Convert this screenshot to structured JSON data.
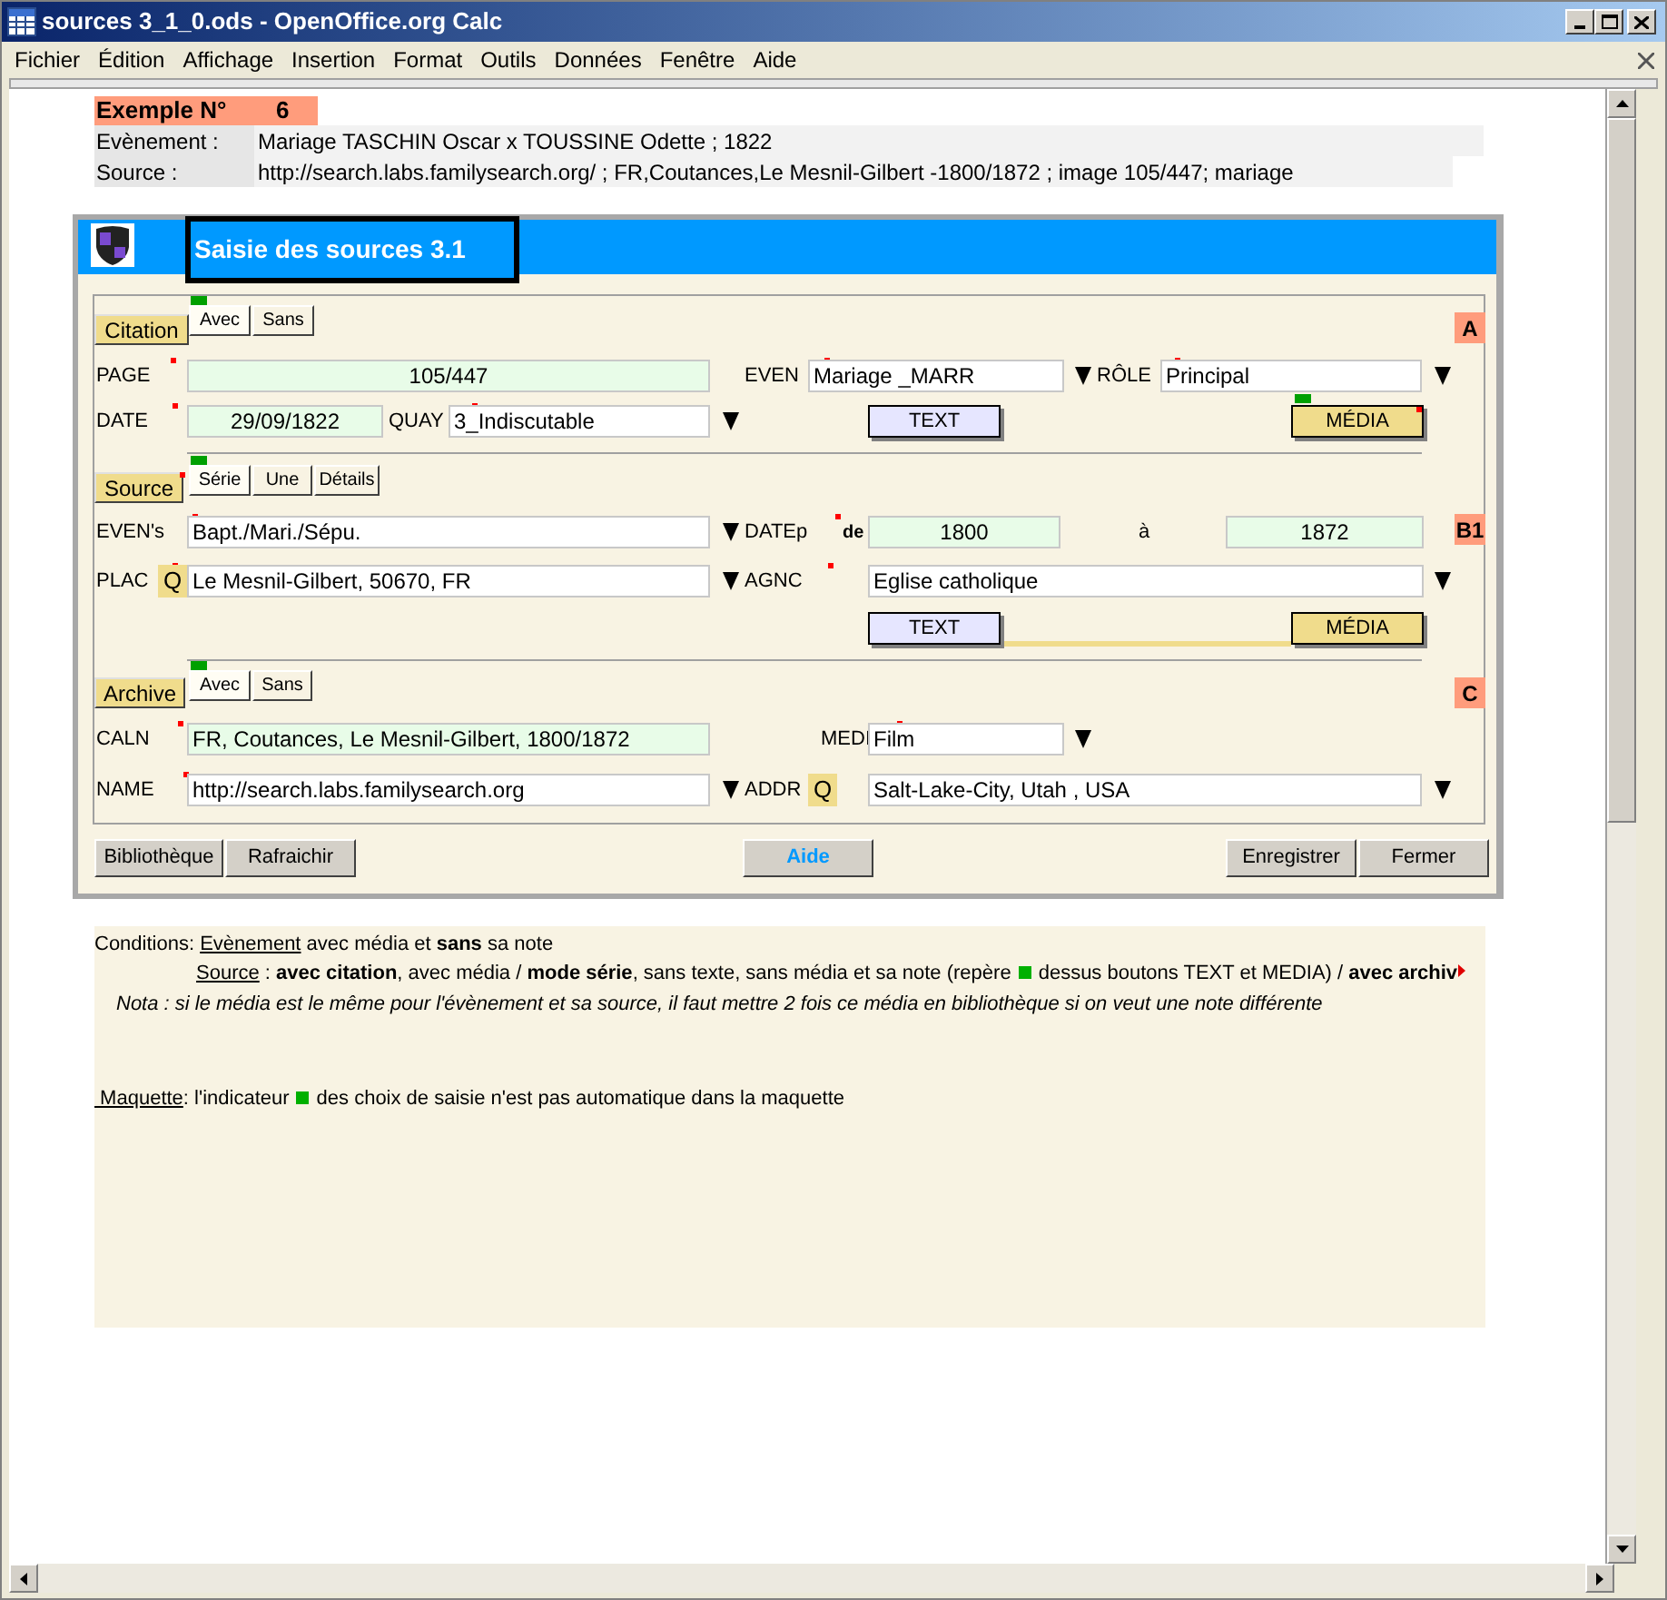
{
  "window": {
    "title": "sources 3_1_0.ods - OpenOffice.org Calc"
  },
  "menu": [
    "Fichier",
    "Édition",
    "Affichage",
    "Insertion",
    "Format",
    "Outils",
    "Données",
    "Fenêtre",
    "Aide"
  ],
  "header": {
    "example_label": "Exemple N°",
    "example_number": "6",
    "rows": [
      {
        "label": "Evènement :",
        "value": "Mariage TASCHIN Oscar x TOUSSINE Odette ; 1822"
      },
      {
        "label": "Source :",
        "value": "http://search.labs.familysearch.org/ ; FR,Coutances,Le Mesnil-Gilbert -1800/1872 ; image 105/447; mariage"
      }
    ]
  },
  "form": {
    "title": "Saisie des sources 3.1",
    "sections": [
      {
        "button": {
          "label": "Citation",
          "marked": false
        },
        "options": [
          {
            "label": "Avec",
            "selected": true
          },
          {
            "label": "Sans",
            "selected": false
          }
        ],
        "badge": "A",
        "connector": false,
        "fields": [
          {
            "label": "PAGE",
            "value": "105/447",
            "required": true,
            "tinted": true,
            "dropdown": false
          },
          {
            "label": "EVEN",
            "value": "Mariage _MARR",
            "required": true,
            "tinted": false,
            "dropdown": true
          },
          {
            "label": "RÔLE",
            "value": "Principal",
            "required": true,
            "tinted": false,
            "dropdown": true
          },
          {
            "label": "DATE",
            "value": "29/09/1822",
            "required": true,
            "tinted": true,
            "dropdown": false
          },
          {
            "label": "QUAY",
            "value": "3_Indiscutable",
            "required": true,
            "tinted": false,
            "dropdown": true
          }
        ],
        "actions": [
          {
            "label": "TEXT",
            "kind": "text"
          },
          {
            "label": "MÉDIA",
            "kind": "media",
            "indicator": true,
            "marked": true
          }
        ]
      },
      {
        "button": {
          "label": "Source",
          "marked": true
        },
        "options": [
          {
            "label": "Série",
            "selected": true
          },
          {
            "label": "Une",
            "selected": false
          },
          {
            "label": "Détails",
            "selected": false
          }
        ],
        "badge": "B1",
        "connector": true,
        "fields": [
          {
            "label": "EVEN's",
            "value": "Bapt./Mari./Sépu.",
            "required": true,
            "tinted": false,
            "dropdown": true
          },
          {
            "label": "DATEp",
            "suffix": "de",
            "value": "1800",
            "required": true,
            "tinted": true,
            "dropdown": false
          },
          {
            "label": "à",
            "value": "1872",
            "required": false,
            "tinted": true,
            "dropdown": false
          },
          {
            "label": "PLAC",
            "search_button": "Q",
            "value": "Le Mesnil-Gilbert, 50670, FR",
            "required": true,
            "tinted": false,
            "dropdown": true
          },
          {
            "label": "AGNC",
            "value": "Eglise catholique",
            "required": true,
            "tinted": false,
            "dropdown": true
          }
        ],
        "actions": [
          {
            "label": "TEXT",
            "kind": "text"
          },
          {
            "label": "MÉDIA",
            "kind": "media"
          }
        ]
      },
      {
        "button": {
          "label": "Archive",
          "marked": false
        },
        "options": [
          {
            "label": "Avec",
            "selected": true
          },
          {
            "label": "Sans",
            "selected": false
          }
        ],
        "badge": "C",
        "connector": false,
        "fields": [
          {
            "label": "CALN",
            "value": "FR, Coutances, Le Mesnil-Gilbert, 1800/1872",
            "required": true,
            "tinted": true,
            "dropdown": false
          },
          {
            "label": "MEDI",
            "value": "Film",
            "required": true,
            "tinted": false,
            "dropdown": true
          },
          {
            "label": "NAME",
            "value": "http://search.labs.familysearch.org",
            "required": true,
            "tinted": false,
            "dropdown": true
          },
          {
            "label": "ADDR",
            "search_button": "Q",
            "value": "Salt-Lake-City, Utah , USA",
            "required": false,
            "tinted": false,
            "dropdown": true
          }
        ]
      }
    ],
    "buttons": [
      {
        "label": "Bibliothèque",
        "kind": "plain"
      },
      {
        "label": "Rafraichir",
        "kind": "plain"
      },
      {
        "label": "Aide",
        "kind": "help"
      },
      {
        "label": "Enregistrer",
        "kind": "plain"
      },
      {
        "label": "Fermer",
        "kind": "plain"
      }
    ]
  },
  "notes": [
    {
      "kind": "text",
      "prefix": "Conditions: ",
      "underlined": "Evènement",
      "parts": [
        " avec média et **sans** sa note"
      ]
    },
    {
      "kind": "text",
      "underlined": "Source",
      "parts": [
        " : **avec citation**, avec média / **mode série**, sans texte, sans média et sa note (repère",
        "dessus boutons TEXT et MEDIA) / **avec archiv**"
      ],
      "overflow": true
    },
    {
      "kind": "italic",
      "parts": [
        "Nota : si le média est le même pour l'évènement et sa source, il faut mettre 2 fois ce média en bibliothèque si on veut une note différente"
      ]
    },
    {
      "kind": "text",
      "underlined": " Maquette",
      "parts": [
        ": l'indicateur",
        "des choix de saisie n'est pas automatique dans la maquette"
      ]
    }
  ]
}
